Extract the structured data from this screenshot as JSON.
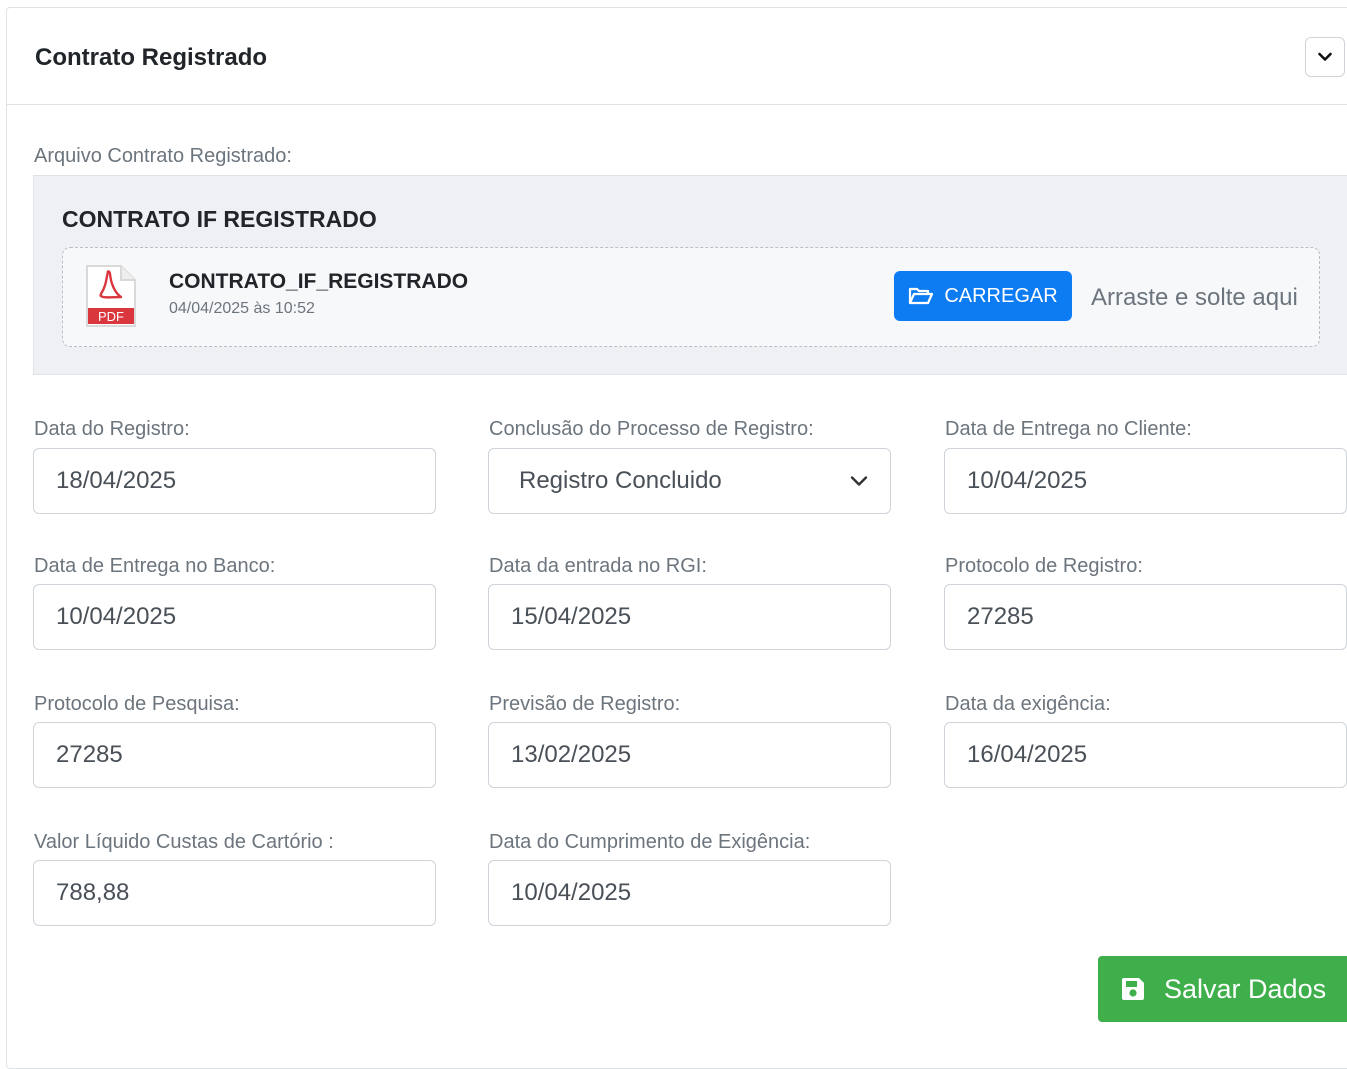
{
  "card": {
    "title": "Contrato Registrado",
    "collapse_icon": "chevron-down-icon"
  },
  "upload": {
    "label": "Arquivo Contrato Registrado:",
    "section_title": "CONTRATO IF REGISTRADO",
    "file_name": "CONTRATO_IF_REGISTRADO",
    "file_date": "04/04/2025 às 10:52",
    "file_icon": "pdf-file-icon",
    "file_icon_text": "PDF",
    "button_label": "CARREGAR",
    "button_icon": "folder-open-icon",
    "drop_hint": "Arraste e solte aqui",
    "button_color": "#0d7cf2"
  },
  "fields": {
    "data_registro": {
      "label": "Data do Registro:",
      "value": "18/04/2025"
    },
    "conclusao": {
      "label": "Conclusão do Processo de Registro:",
      "value": "Registro Concluido"
    },
    "data_entrega_cliente": {
      "label": "Data de Entrega no Cliente:",
      "value": "10/04/2025"
    },
    "data_entrega_banco": {
      "label": "Data de Entrega no Banco:",
      "value": "10/04/2025"
    },
    "data_entrada_rgi": {
      "label": "Data da entrada no RGI:",
      "value": "15/04/2025"
    },
    "protocolo_registro": {
      "label": "Protocolo de Registro:",
      "value": "27285"
    },
    "protocolo_pesquisa": {
      "label": "Protocolo de Pesquisa:",
      "value": "27285"
    },
    "previsao_registro": {
      "label": "Previsão de Registro:",
      "value": "13/02/2025"
    },
    "data_exigencia": {
      "label": "Data da exigência:",
      "value": "16/04/2025"
    },
    "valor_custas": {
      "label": "Valor Líquido Custas de Cartório :",
      "value": "788,88"
    },
    "data_cumprimento": {
      "label": "Data do Cumprimento de Exigência:",
      "value": "10/04/2025"
    }
  },
  "actions": {
    "save_label": "Salvar Dados",
    "save_icon": "floppy-disk-icon",
    "save_color": "#3eaf4a"
  }
}
